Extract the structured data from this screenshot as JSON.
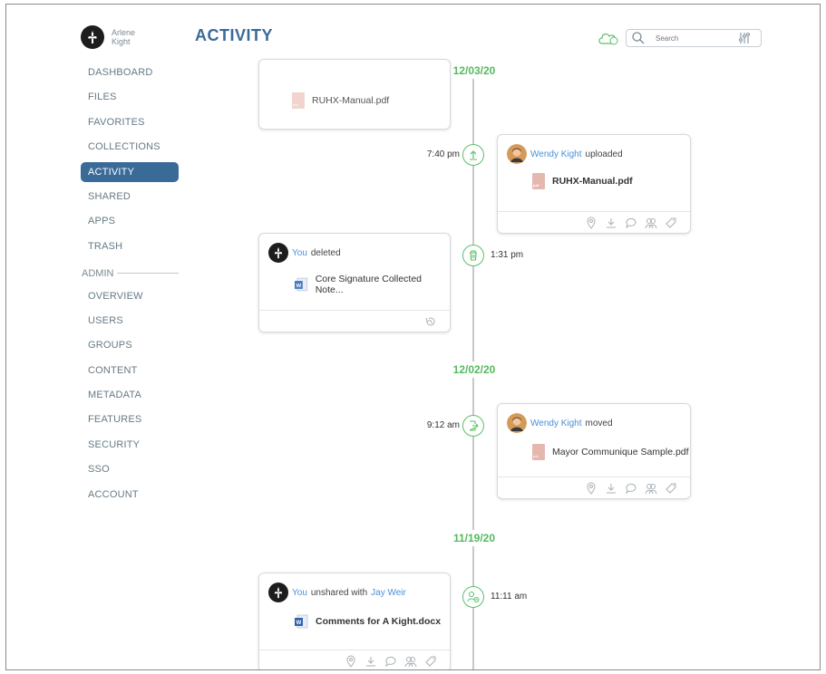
{
  "user": {
    "first": "Arlene",
    "last": "Kight"
  },
  "header": {
    "title": "ACTIVITY",
    "search_placeholder": "Search",
    "cloud_badge": "2"
  },
  "nav": [
    {
      "label": "DASHBOARD"
    },
    {
      "label": "FILES"
    },
    {
      "label": "FAVORITES"
    },
    {
      "label": "COLLECTIONS"
    },
    {
      "label": "ACTIVITY",
      "active": true
    },
    {
      "label": "SHARED"
    },
    {
      "label": "APPS"
    },
    {
      "label": "TRASH"
    }
  ],
  "admin_label": "ADMIN",
  "admin_nav": [
    {
      "label": "OVERVIEW"
    },
    {
      "label": "USERS"
    },
    {
      "label": "GROUPS"
    },
    {
      "label": "CONTENT"
    },
    {
      "label": "METADATA"
    },
    {
      "label": "FEATURES"
    },
    {
      "label": "SECURITY"
    },
    {
      "label": "SSO"
    },
    {
      "label": "ACCOUNT"
    }
  ],
  "timeline": {
    "dates": [
      "12/03/20",
      "12/02/20",
      "11/19/20"
    ],
    "events": [
      {
        "file": "RUHX-Manual.pdf"
      },
      {
        "time": "7:40 pm",
        "who": "Wendy Kight",
        "verb": "uploaded",
        "file": "RUHX-Manual.pdf"
      },
      {
        "time": "1:31 pm",
        "who": "You",
        "verb": "deleted",
        "file": "Core Signature Collected Note..."
      },
      {
        "time": "9:12 am",
        "who": "Wendy Kight",
        "verb": "moved",
        "file": "Mayor Communique Sample.pdf"
      },
      {
        "time": "11:11 am",
        "who": "You",
        "verb": "unshared with",
        "target": "Jay Weir",
        "file": "Comments for A Kight.docx"
      }
    ]
  },
  "colors": {
    "accent": "#3a6a98",
    "green": "#55b95f",
    "link": "#4a90d9"
  }
}
